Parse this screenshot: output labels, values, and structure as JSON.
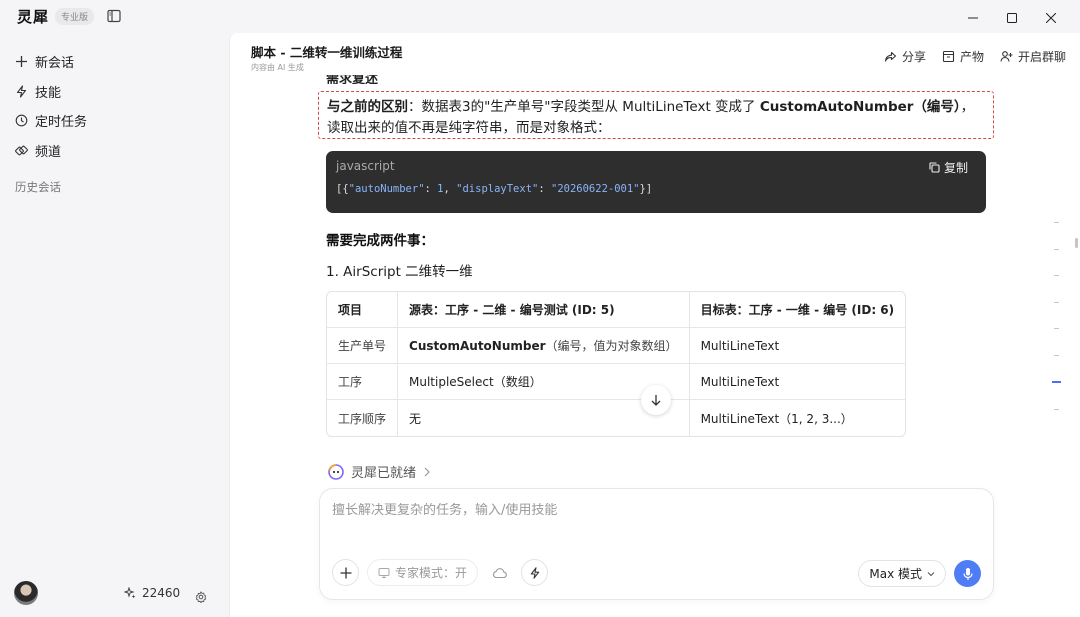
{
  "app": {
    "name": "灵犀",
    "badge": "专业版"
  },
  "sidebar": {
    "items": [
      {
        "label": "新会话",
        "icon": "plus-icon"
      },
      {
        "label": "技能",
        "icon": "lightning-icon"
      },
      {
        "label": "定时任务",
        "icon": "clock-icon"
      },
      {
        "label": "频道",
        "icon": "channel-icon"
      }
    ],
    "history_label": "历史会话",
    "points": "22460"
  },
  "header": {
    "title": "脚本 - 二维转一维训练过程",
    "subtitle": "内容由 AI 生成",
    "actions": {
      "share": "分享",
      "artifacts": "产物",
      "group_chat": "开启群聊"
    }
  },
  "message": {
    "cut_heading": "需求复述",
    "highlight": {
      "lead": "与之前的区别",
      "text1": "：数据表3的\"生产单号\"字段类型从 MultiLineText 变成了 ",
      "strong": "CustomAutoNumber（编号）",
      "text2": "，读取出来的值不再是纯字符串，而是对象格式："
    },
    "code": {
      "lang": "javascript",
      "copy_label": "复制",
      "tokens": {
        "p1": "[{",
        "k1": "\"autoNumber\"",
        "p2": ": ",
        "n1": "1",
        "p3": ", ",
        "k2": "\"displayText\"",
        "p4": ": ",
        "s1": "\"20260622-001\"",
        "p5": "}]"
      }
    },
    "need_heading": "需要完成两件事：",
    "step1": "1. AirScript 二维转一维",
    "table": {
      "headers": [
        "项目",
        "源表：工序 - 二维 - 编号测试 (ID: 5)",
        "目标表：工序 - 一维 - 编号 (ID: 6)"
      ],
      "rows": [
        {
          "c1": "生产单号",
          "c2_bold": "CustomAutoNumber",
          "c2": "（编号，值为对象数组）",
          "c3": "MultiLineText"
        },
        {
          "c1": "工序",
          "c2_bold": "",
          "c2": "MultipleSelect（数组）",
          "c3": "MultiLineText"
        },
        {
          "c1": "工序顺序",
          "c2_bold": "",
          "c2": "无",
          "c3": "MultiLineText（1, 2, 3...）"
        }
      ]
    }
  },
  "status": {
    "text": "灵犀已就绪"
  },
  "composer": {
    "placeholder": "擅长解决更复杂的任务，输入/使用技能",
    "expert_mode": "专家模式：开",
    "mode": "Max 模式"
  },
  "colors": {
    "accent": "#4f7df5",
    "highlight_border": "#d24b43",
    "code_bg": "#2e2e2e"
  }
}
